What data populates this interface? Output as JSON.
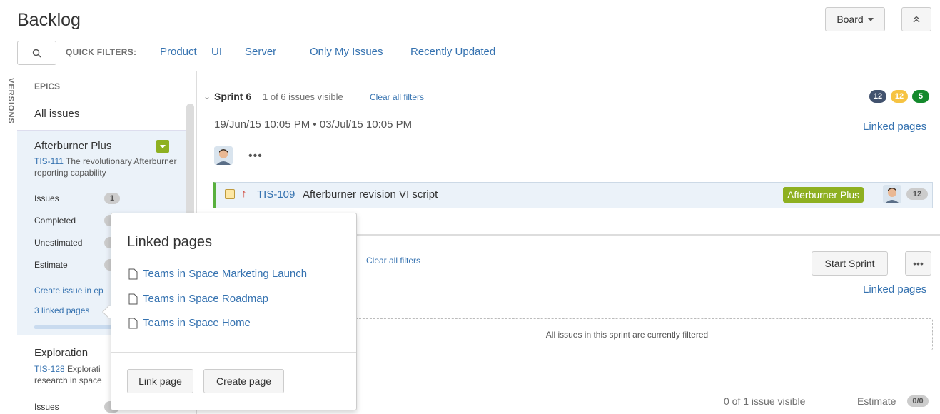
{
  "header": {
    "title": "Backlog",
    "board_label": "Board",
    "collapse_icon": "double-chevron-up"
  },
  "filters": {
    "label": "QUICK FILTERS:",
    "items": [
      "Product",
      "UI",
      "Server",
      "Only My Issues",
      "Recently Updated"
    ]
  },
  "side_tab": {
    "versions": "VERSIONS"
  },
  "epics": {
    "label": "EPICS",
    "all_issues": "All issues",
    "selected": {
      "name": "Afterburner Plus",
      "key": "TIS-111",
      "desc": " The revolutionary Afterburner reporting capability",
      "color": "#8eb021",
      "stats": [
        {
          "label": "Issues",
          "value": "1"
        },
        {
          "label": "Completed",
          "value": ""
        },
        {
          "label": "Unestimated",
          "value": ""
        },
        {
          "label": "Estimate",
          "value": ""
        }
      ],
      "create_issue": "Create issue in ep",
      "linked_pages": "3 linked pages"
    },
    "next": {
      "name": "Exploration",
      "key": "TIS-128",
      "desc_line1": " Explorati",
      "desc_line2": "research in space",
      "issues_label": "Issues"
    }
  },
  "sprint": {
    "name": "Sprint 6",
    "visible": "1 of 6 issues visible",
    "clear": "Clear all filters",
    "counts": [
      {
        "value": "12",
        "color": "#42526e"
      },
      {
        "value": "12",
        "color": "#f6c342"
      },
      {
        "value": "5",
        "color": "#14892c"
      }
    ],
    "dates": "19/Jun/15 10:05 PM  •  03/Jul/15 10:05 PM",
    "linked_pages": "Linked pages",
    "more": "•••",
    "issue": {
      "key": "TIS-109",
      "summary": "Afterburner revision VI script",
      "priority": "↑",
      "epic": "Afterburner Plus",
      "points": "12"
    }
  },
  "backlog": {
    "clear": "Clear all filters",
    "start_sprint": "Start Sprint",
    "more": "•••",
    "linked_pages": "Linked pages",
    "filtered_msg": "All issues in this sprint are currently filtered",
    "visible": "0 of 1 issue visible",
    "estimate_label": "Estimate",
    "estimate_value": "0/0"
  },
  "popup": {
    "title": "Linked pages",
    "pages": [
      "Teams in Space Marketing Launch",
      "Teams in Space Roadmap",
      "Teams in Space Home"
    ],
    "link_page": "Link page",
    "create_page": "Create page"
  }
}
